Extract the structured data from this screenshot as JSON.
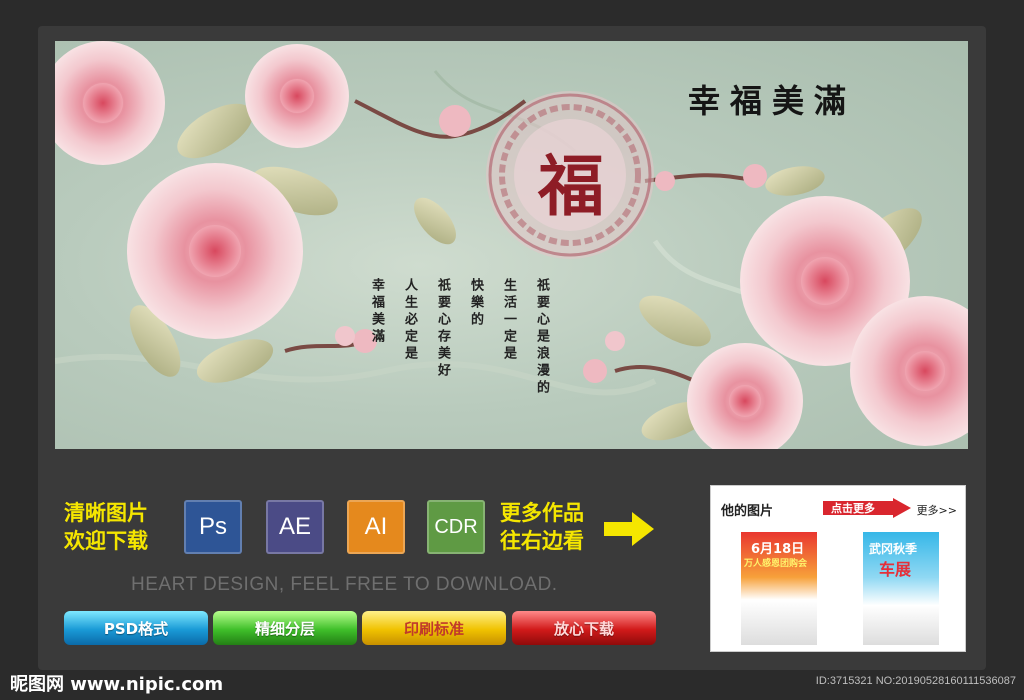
{
  "artwork": {
    "title": "幸福美滿",
    "fu_char": "福",
    "poem_columns": [
      "祇要心是浪漫的",
      "生活一定是",
      "快樂的",
      "祇要心存美好",
      "人生必定是",
      "幸福美滿"
    ]
  },
  "promo": {
    "left_line1": "清晰图片",
    "left_line2": "欢迎下载",
    "badges": [
      "Ps",
      "AE",
      "AI",
      "CDR"
    ],
    "right_line1": "更多作品",
    "right_line2": "往右边看",
    "tagline": "HEART DESIGN, FEEL FREE TO DOWNLOAD.",
    "buttons": [
      "PSD格式",
      "精细分层",
      "印刷标准",
      "放心下载"
    ]
  },
  "side_panel": {
    "title": "他的图片",
    "click_more": "点击更多",
    "more": "更多>>",
    "thumb1_line1": "6月18日",
    "thumb1_line2": "万人感恩团购会",
    "thumb2_line1": "武冈秋季",
    "thumb2_line2": "车展"
  },
  "footer": {
    "site": "昵图网 www.nipic.com",
    "id_text": "ID:3715321 NO:20190528160111536087"
  },
  "colors": {
    "background": "#2b2b2b",
    "yellow_text": "#f5e600",
    "badge_ps": "#2e5596",
    "badge_ae": "#4b4b86",
    "badge_ai": "#e5891d",
    "badge_cdr": "#5f9a44",
    "fu_red": "#8e1d26"
  }
}
